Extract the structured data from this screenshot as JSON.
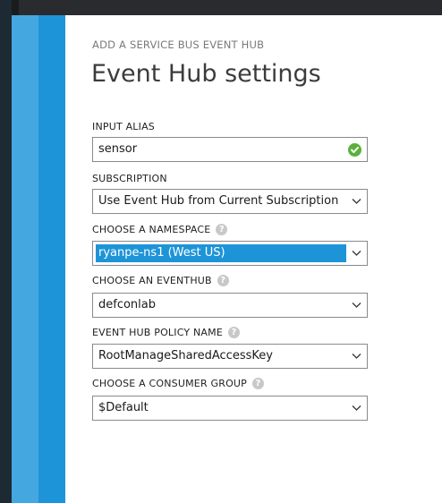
{
  "panel": {
    "breadcrumb": "ADD A SERVICE BUS EVENT HUB",
    "title": "Event Hub settings"
  },
  "fields": {
    "input_alias": {
      "label": "INPUT ALIAS",
      "value": "sensor",
      "status_icon": "check-circle-icon",
      "status_color": "#5bb13c"
    },
    "subscription": {
      "label": "SUBSCRIPTION",
      "value": "Use Event Hub from Current Subscription"
    },
    "namespace": {
      "label": "CHOOSE A NAMESPACE",
      "value": "ryanpe-ns1 (West US)",
      "help_icon": "?"
    },
    "eventhub": {
      "label": "CHOOSE AN EVENTHUB",
      "value": "defconlab",
      "help_icon": "?"
    },
    "policy": {
      "label": "EVENT HUB POLICY NAME",
      "value": "RootManageSharedAccessKey",
      "help_icon": "?"
    },
    "consumer_group": {
      "label": "CHOOSE A CONSUMER GROUP",
      "value": "$Default",
      "help_icon": "?"
    }
  },
  "colors": {
    "accent": "#1e94d8",
    "accent_light": "#44a7e0",
    "success": "#5bb13c"
  }
}
